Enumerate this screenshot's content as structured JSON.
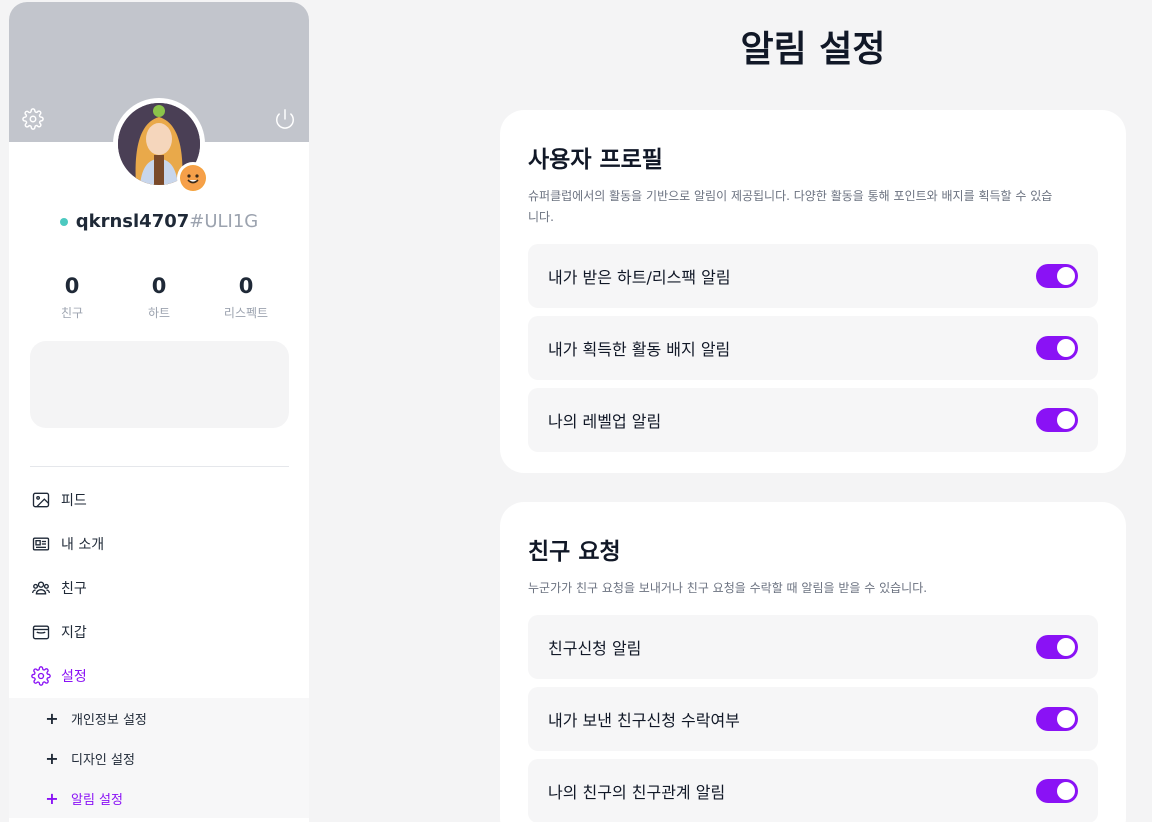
{
  "page": {
    "title": "알림 설정"
  },
  "profile": {
    "username": "qkrnsl4707",
    "tag": "#ULI1G",
    "stats": [
      {
        "value": "0",
        "label": "친구"
      },
      {
        "value": "0",
        "label": "하트"
      },
      {
        "value": "0",
        "label": "리스펙트"
      }
    ]
  },
  "menu": {
    "items": [
      {
        "label": "피드",
        "icon": "image-icon"
      },
      {
        "label": "내 소개",
        "icon": "id-card-icon"
      },
      {
        "label": "친구",
        "icon": "friends-icon"
      },
      {
        "label": "지갑",
        "icon": "wallet-icon"
      },
      {
        "label": "설정",
        "icon": "gear-icon",
        "active": true
      }
    ],
    "submenu": [
      {
        "label": "개인정보 설정"
      },
      {
        "label": "디자인 설정"
      },
      {
        "label": "알림 설정",
        "active": true
      }
    ]
  },
  "sections": [
    {
      "title": "사용자 프로필",
      "description": "슈퍼클럽에서의 활동을 기반으로 알림이 제공됩니다. 다양한 활동을 통해 포인트와 배지를 획득할 수 있습니다.",
      "toggles": [
        {
          "label": "내가 받은 하트/리스팩 알림",
          "on": true
        },
        {
          "label": "내가 획득한 활동 배지 알림",
          "on": true
        },
        {
          "label": "나의 레벨업 알림",
          "on": true
        }
      ]
    },
    {
      "title": "친구 요청",
      "description": "누군가가 친구 요청을 보내거나 친구 요청을 수락할 때 알림을 받을 수 있습니다.",
      "toggles": [
        {
          "label": "친구신청 알림",
          "on": true
        },
        {
          "label": "내가 보낸 친구신청 수락여부",
          "on": true
        },
        {
          "label": "나의 친구의 친구관계 알림",
          "on": true
        }
      ]
    }
  ],
  "colors": {
    "accent": "#8a12f5",
    "online": "#4cc9c0",
    "cover": "#c2c5cc"
  }
}
